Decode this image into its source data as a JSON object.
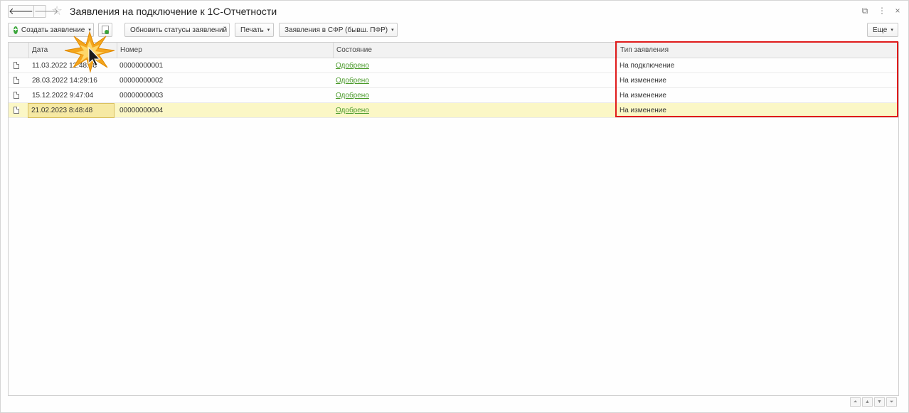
{
  "window": {
    "title": "Заявления на подключение к 1С-Отчетности",
    "nav_back": "🡐",
    "nav_forward": "🡒",
    "icons": {
      "link": "⧉",
      "more": "⋮",
      "close": "×"
    }
  },
  "toolbar": {
    "create": "Создать заявление",
    "refresh_statuses": "Обновить статусы заявлений",
    "print": "Печать",
    "sfr": "Заявления в СФР (бывш. ПФР)",
    "more": "Еще"
  },
  "table": {
    "columns": {
      "date": "Дата",
      "number": "Номер",
      "status": "Состояние",
      "type": "Тип заявления"
    },
    "rows": [
      {
        "date": "11.03.2022 12:48:38",
        "number": "00000000001",
        "status": "Одобрено",
        "type": "На подключение"
      },
      {
        "date": "28.03.2022 14:29:16",
        "number": "00000000002",
        "status": "Одобрено",
        "type": "На изменение"
      },
      {
        "date": "15.12.2022 9:47:04",
        "number": "00000000003",
        "status": "Одобрено",
        "type": "На изменение"
      },
      {
        "date": "21.02.2023 8:48:48",
        "number": "00000000004",
        "status": "Одобрено",
        "type": "На изменение"
      }
    ]
  },
  "colors": {
    "highlight": "#e01b1b",
    "link": "#4a9a2a",
    "selected_row": "#fbf7c6",
    "burst": "#f4a51c"
  }
}
